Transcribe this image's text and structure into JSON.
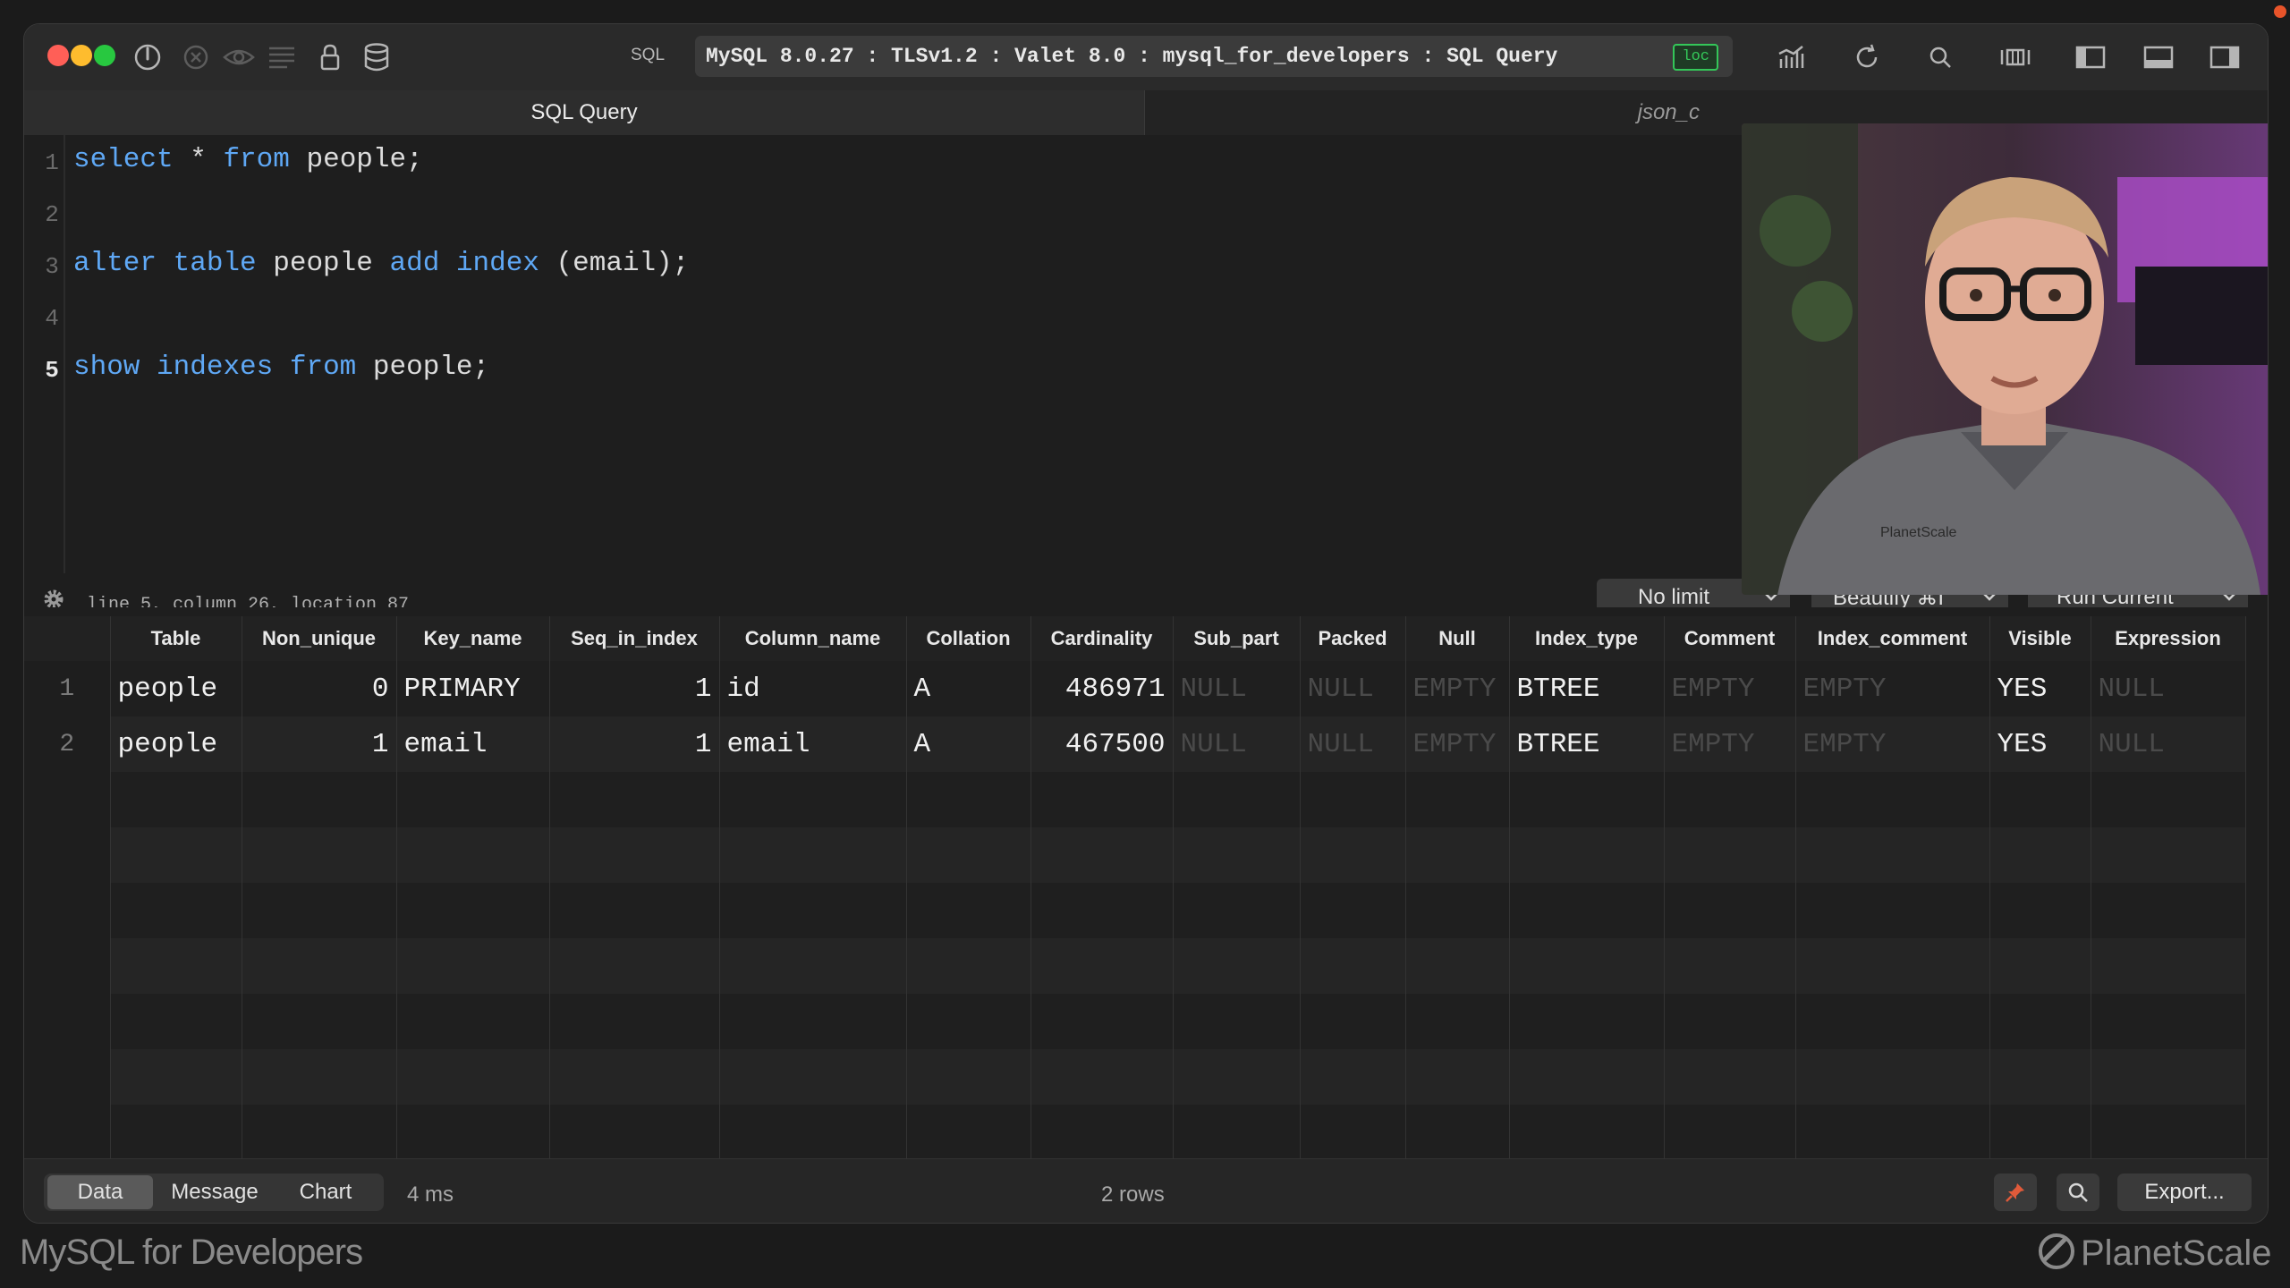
{
  "window": {
    "address": "MySQL 8.0.27 : TLSv1.2 : Valet 8.0 : mysql_for_developers : SQL Query",
    "badge": "loc",
    "sql_label": "SQL"
  },
  "tabs": [
    {
      "label": "SQL Query",
      "active": true
    },
    {
      "label": "json_c",
      "active": false
    }
  ],
  "editor": {
    "lines": [
      {
        "n": "1",
        "code": "select * from people;"
      },
      {
        "n": "2",
        "code": ""
      },
      {
        "n": "3",
        "code": "alter table people add index (email);"
      },
      {
        "n": "4",
        "code": ""
      },
      {
        "n": "5",
        "code": "show indexes from people;"
      }
    ],
    "status": "line 5, column 26, location 87",
    "limit_label": "No limit",
    "beautify_label": "Beautify ⌘I",
    "run_label": "Run Current"
  },
  "results": {
    "columns": [
      "Table",
      "Non_unique",
      "Key_name",
      "Seq_in_index",
      "Column_name",
      "Collation",
      "Cardinality",
      "Sub_part",
      "Packed",
      "Null",
      "Index_type",
      "Comment",
      "Index_comment",
      "Visible",
      "Expression"
    ],
    "rows": [
      [
        "1",
        "people",
        "0",
        "PRIMARY",
        "1",
        "id",
        "A",
        "486971",
        "NULL",
        "NULL",
        "EMPTY",
        "BTREE",
        "EMPTY",
        "EMPTY",
        "YES",
        "NULL"
      ],
      [
        "2",
        "people",
        "1",
        "email",
        "1",
        "email",
        "A",
        "467500",
        "NULL",
        "NULL",
        "EMPTY",
        "BTREE",
        "EMPTY",
        "EMPTY",
        "YES",
        "NULL"
      ]
    ]
  },
  "bottom": {
    "tabs": [
      "Data",
      "Message",
      "Chart"
    ],
    "active_tab": "Data",
    "time": "4 ms",
    "row_count": "2 rows",
    "export_label": "Export..."
  },
  "branding": {
    "left": "MySQL for Developers",
    "right": "PlanetScale"
  },
  "colors": {
    "keyword": "#5fa8f5",
    "close": "#ff5f57",
    "minimize": "#febc2e",
    "maximize": "#28c840",
    "accent_pin": "#e05a3a"
  }
}
